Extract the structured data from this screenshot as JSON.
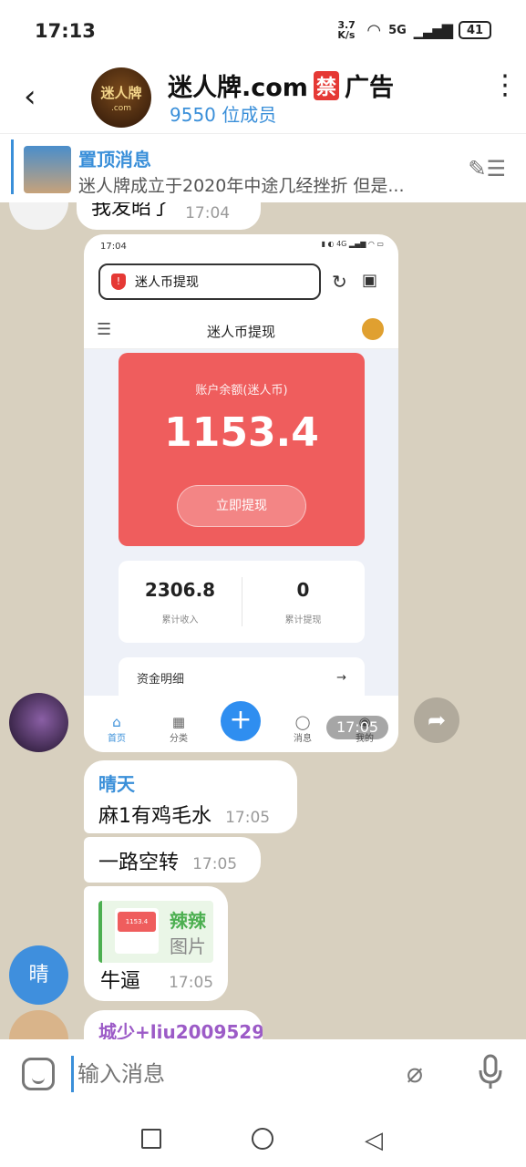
{
  "status_bar": {
    "time": "17:13",
    "speed": "3.7 K/s",
    "network": "5G",
    "battery": "41"
  },
  "header": {
    "title": "迷人牌.com",
    "ban_badge": "禁",
    "ad_label": "广告",
    "members": "9550 位成员",
    "avatar_text": "迷人牌",
    "avatar_sub": ".com"
  },
  "pinned": {
    "title": "置顶消息",
    "text": "迷人牌成立于2020年中途几经挫折 但是..."
  },
  "messages": {
    "partial_top": {
      "text": "我发昭了",
      "time": "17:04"
    },
    "screenshot": {
      "time": "17:05",
      "phone_time": "17:04",
      "url_label": "迷人币提现",
      "nav_title": "迷人币提现",
      "balance_label": "账户余额(迷人币)",
      "balance": "1153.4",
      "withdraw_button": "立即提现",
      "stat_income_value": "2306.8",
      "stat_income_label": "累计收入",
      "stat_withdraw_value": "0",
      "stat_withdraw_label": "累计提现",
      "detail_label": "资金明细",
      "tabs": [
        "首页",
        "分类",
        "消息",
        "我的"
      ]
    },
    "msg1": {
      "sender": "晴天",
      "text": "麻1有鸡毛水",
      "time": "17:05"
    },
    "msg2": {
      "text": "一路空转",
      "time": "17:05"
    },
    "msg3": {
      "reply_name": "辣辣",
      "reply_text": "图片",
      "text": "牛逼",
      "time": "17:05",
      "avatar_text": "晴",
      "thumb_value": "1153.4"
    },
    "msg4": {
      "sender": "城少+liu2009529"
    }
  },
  "input": {
    "placeholder": "输入消息"
  },
  "colors": {
    "accent": "#3a8fd9",
    "card_red": "#ef5d5d",
    "chat_bg": "#d8d0bf"
  }
}
